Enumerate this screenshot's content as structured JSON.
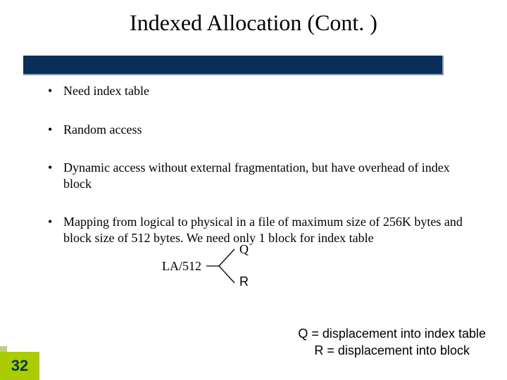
{
  "title": "Indexed Allocation (Cont. )",
  "bullets": [
    "Need index table",
    "Random access",
    "Dynamic access without external fragmentation, but have overhead of index block",
    "Mapping from logical to physical in a file of maximum size of 256K bytes and block size of 512 bytes.  We need only 1 block for index table"
  ],
  "diagram": {
    "input": "LA/512",
    "outTop": "Q",
    "outBottom": "R"
  },
  "legend": {
    "line1": "Q = displacement into index table",
    "line2": "R = displacement into block"
  },
  "pageNumber": "32"
}
